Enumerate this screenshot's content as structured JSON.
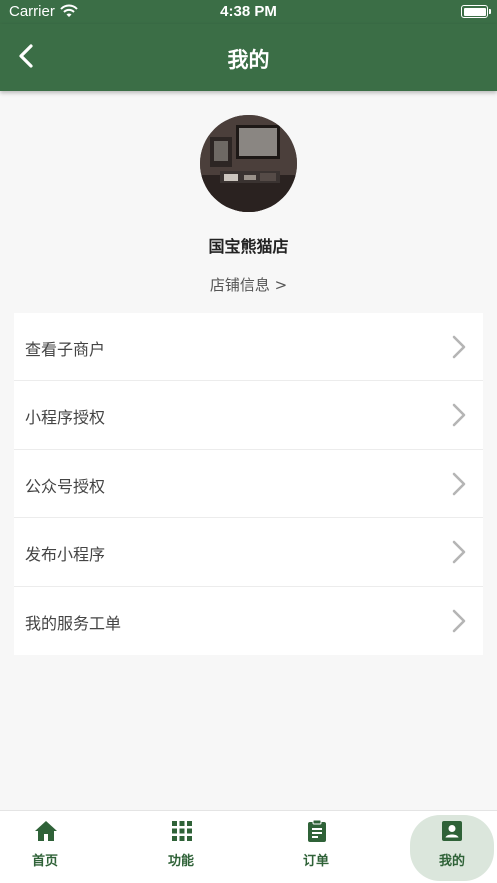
{
  "status_bar": {
    "carrier": "Carrier",
    "time": "4:38 PM"
  },
  "nav": {
    "title": "我的"
  },
  "profile": {
    "store_name": "国宝熊猫店",
    "store_info_link": "店铺信息 >"
  },
  "menu": [
    {
      "label": "查看子商户"
    },
    {
      "label": "小程序授权"
    },
    {
      "label": "公众号授权"
    },
    {
      "label": "发布小程序"
    },
    {
      "label": "我的服务工单"
    }
  ],
  "tabs": [
    {
      "label": "首页",
      "icon": "home-icon"
    },
    {
      "label": "功能",
      "icon": "grid-icon"
    },
    {
      "label": "订单",
      "icon": "clipboard-icon"
    },
    {
      "label": "我的",
      "icon": "profile-icon",
      "active": true
    }
  ],
  "colors": {
    "primary": "#3b6e46",
    "tab_text": "#2f6238",
    "active_tab_bg": "#dbe6dc"
  }
}
